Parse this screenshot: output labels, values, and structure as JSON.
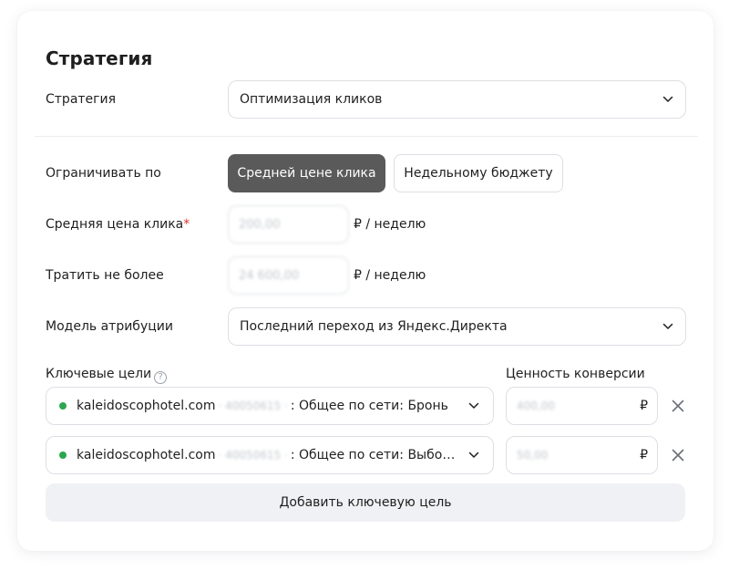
{
  "section_title": "Стратегия",
  "strategy": {
    "label": "Стратегия",
    "value": "Оптимизация кликов"
  },
  "limit": {
    "label": "Ограничивать по",
    "options": [
      "Средней цене клика",
      "Недельному бюджету"
    ],
    "selected": "Средней цене клика"
  },
  "avg_click_price": {
    "label": "Средняя цена клика",
    "required_mark": "*",
    "value": "200,00",
    "suffix": "₽ / неделю"
  },
  "spend_limit": {
    "label": "Тратить не более",
    "value": "24 600,00",
    "suffix": "₽ / неделю"
  },
  "attribution": {
    "label": "Модель атрибуции",
    "value": "Последний переход из Яндекс.Директа"
  },
  "goals": {
    "label": "Ключевые цели",
    "help_glyph": "?",
    "value_header": "Ценность конверсии",
    "currency": "₽",
    "items": [
      {
        "domain": "kaleidoscophotel.com",
        "id": "· 40050615 ·",
        "name": ": Общее по сети: Бронь",
        "value": "400,00",
        "status_color": "#2ca64e"
      },
      {
        "domain": "kaleidoscophotel.com",
        "id": "· 40050615 ·",
        "name": ": Общее по сети: Выбор ...",
        "value": "50,00",
        "status_color": "#2ca64e"
      }
    ],
    "add_label": "Добавить ключевую цель"
  },
  "icons": {
    "chevron": "chevron-down-icon",
    "close": "close-icon",
    "help": "help-circle-icon",
    "status": "status-dot-icon"
  }
}
